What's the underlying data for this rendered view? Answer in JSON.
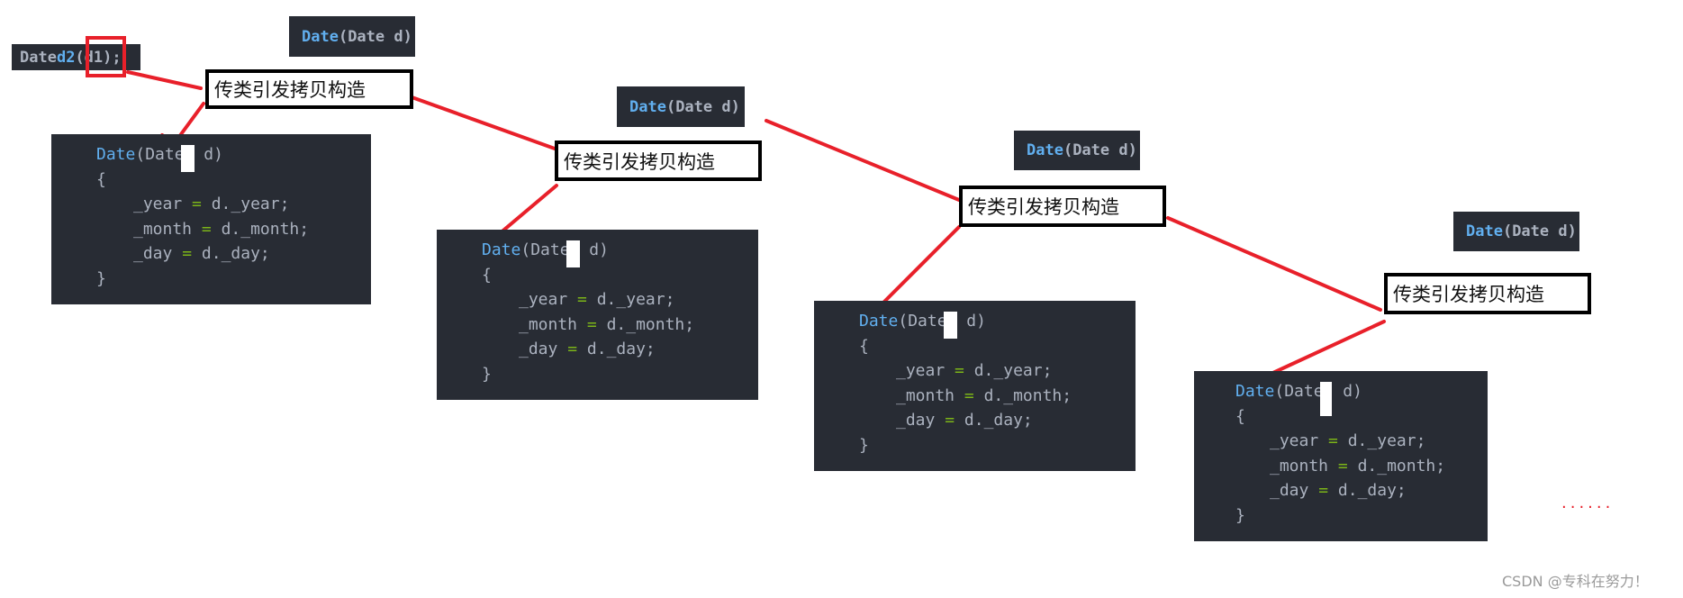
{
  "call": {
    "type": "Date",
    "var": "d2",
    "arg": "(d1)",
    "end": ";"
  },
  "signature": {
    "name": "Date",
    "params": "(Date d)"
  },
  "label": "传类引发拷贝构造",
  "code": {
    "name": "Date",
    "open_params": "(Date",
    "close_params": " d)",
    "open_brace": "{",
    "lines": [
      {
        "lhs": "_year",
        "op": "=",
        "rhs": "d._year;"
      },
      {
        "lhs": "_month",
        "op": "=",
        "rhs": "d._month;"
      },
      {
        "lhs": "_day",
        "op": "=",
        "rhs": "d._day;"
      }
    ],
    "close_brace": "}"
  },
  "ellipsis": "......",
  "watermark": "CSDN @专科在努力！",
  "colors": {
    "code_bg": "#282c34",
    "keyword": "#61afef",
    "operator": "#7cb518",
    "arrow": "#e8202a"
  }
}
